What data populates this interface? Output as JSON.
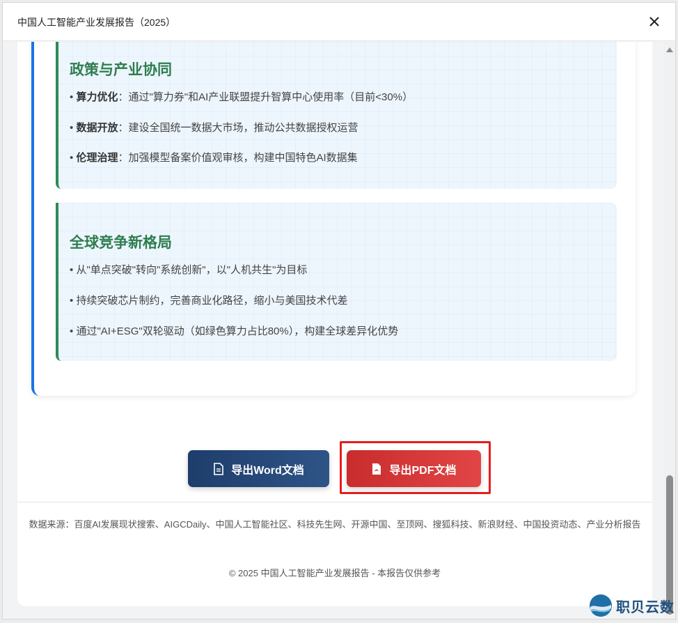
{
  "window": {
    "title": "中国人工智能产业发展报告（2025）"
  },
  "cards": [
    {
      "title": "政策与产业协同",
      "items": [
        {
          "bold": "算力优化",
          "sep": "：",
          "text": "通过\"算力券\"和AI产业联盟提升智算中心使用率（目前<30%）"
        },
        {
          "bold": "数据开放",
          "sep": "：",
          "text": "建设全国统一数据大市场，推动公共数据授权运营"
        },
        {
          "bold": "伦理治理",
          "sep": "：",
          "text": "加强模型备案价值观审核，构建中国特色AI数据集"
        }
      ]
    },
    {
      "title": "全球竞争新格局",
      "items": [
        {
          "text": "从\"单点突破\"转向\"系统创新\"，以\"人机共生\"为目标"
        },
        {
          "text": "持续突破芯片制约，完善商业化路径，缩小与美国技术代差"
        },
        {
          "text": "通过\"AI+ESG\"双轮驱动（如绿色算力占比80%），构建全球差异化优势"
        }
      ]
    }
  ],
  "bullet": "•",
  "buttons": {
    "word": "导出Word文档",
    "pdf": "导出PDF文档"
  },
  "footer": {
    "sources": "数据来源：百度AI发展现状搜索、AIGCDaily、中国人工智能社区、科技先生网、开源中国、至顶网、搜狐科技、新浪财经、中国投资动态、产业分析报告",
    "copyright": "© 2025 中国人工智能产业发展报告 - 本报告仅供参考"
  },
  "watermark": {
    "text": "职贝云数"
  },
  "colors": {
    "accent_blue": "#1a73e8",
    "accent_green": "#2e8b57",
    "word_button": "#1e3d6b",
    "pdf_button": "#d63a3a",
    "highlight": "#e81c1c"
  }
}
